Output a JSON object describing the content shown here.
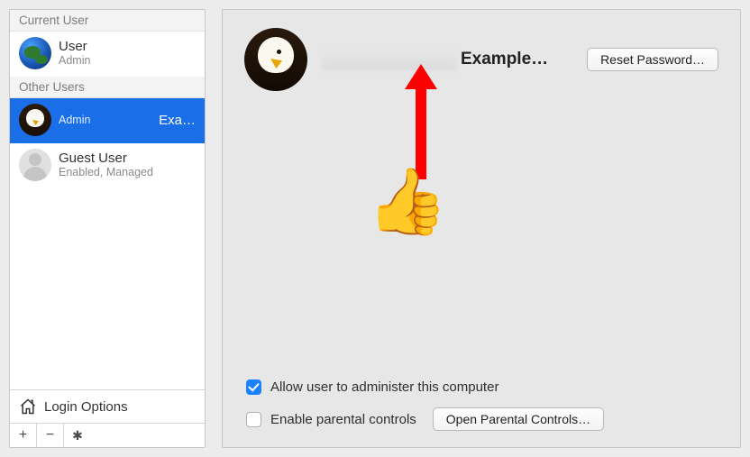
{
  "sidebar": {
    "sections": {
      "current": {
        "header": "Current User",
        "user": {
          "name": "User",
          "role": "Admin",
          "avatar": "earth"
        }
      },
      "other": {
        "header": "Other Users",
        "users": [
          {
            "name": "",
            "name_extra": "Exa…",
            "role": "Admin",
            "avatar": "eagle",
            "selected": true
          },
          {
            "name": "Guest User",
            "role": "Enabled, Managed",
            "avatar": "silhouette",
            "selected": false
          }
        ]
      }
    },
    "login_options_label": "Login Options",
    "toolbar": {
      "add_label": "+",
      "remove_label": "−",
      "actions_label": "✱"
    }
  },
  "main": {
    "display_name_suffix": "Example…",
    "reset_password_label": "Reset Password…",
    "allow_admin": {
      "label": "Allow user to administer this computer",
      "checked": true
    },
    "parental": {
      "label": "Enable parental controls",
      "checked": false,
      "open_button_label": "Open Parental Controls…"
    }
  },
  "annotation": {
    "thumbs_emoji": "👍",
    "arrow_color": "#ff0000"
  }
}
